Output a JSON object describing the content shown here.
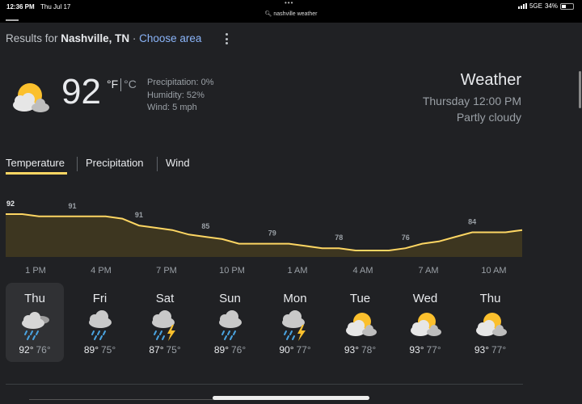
{
  "status_bar": {
    "time": "12:36 PM",
    "date": "Thu Jul 17",
    "dots": "•••",
    "url": "nashville weather",
    "network": "5GE",
    "battery": "34%"
  },
  "header": {
    "results_for": "Results for",
    "location": "Nashville, TN",
    "separator": "·",
    "choose_area": "Choose area"
  },
  "current": {
    "temp": "92",
    "unit_f": "°F",
    "unit_c": "°C",
    "precipitation": "Precipitation: 0%",
    "humidity": "Humidity: 52%",
    "wind": "Wind: 5 mph",
    "title": "Weather",
    "time": "Thursday 12:00 PM",
    "condition": "Partly cloudy",
    "icon": "partly-cloudy-icon"
  },
  "tabs": [
    {
      "label": "Temperature",
      "active": true
    },
    {
      "label": "Precipitation",
      "active": false
    },
    {
      "label": "Wind",
      "active": false
    }
  ],
  "colors": {
    "accent": "#fdd663",
    "chart_fill": "#3d3620",
    "background": "#202124"
  },
  "chart_data": {
    "type": "area",
    "series": [
      {
        "values": [
          92,
          92,
          91,
          91,
          91,
          91,
          91,
          90,
          87,
          86,
          85,
          83,
          82,
          81,
          79,
          79,
          79,
          79,
          78,
          77,
          77,
          76,
          76,
          76,
          77,
          79,
          80,
          82,
          84,
          84,
          84,
          85
        ]
      }
    ],
    "data_labels": [
      {
        "index": 0,
        "text": "92"
      },
      {
        "index": 4,
        "text": "91"
      },
      {
        "index": 8,
        "text": "91"
      },
      {
        "index": 12,
        "text": "85"
      },
      {
        "index": 16,
        "text": "79"
      },
      {
        "index": 20,
        "text": "78"
      },
      {
        "index": 24,
        "text": "76"
      },
      {
        "index": 28,
        "text": "84"
      }
    ],
    "x_labels": [
      "1 PM",
      "4 PM",
      "7 PM",
      "10 PM",
      "1 AM",
      "4 AM",
      "7 AM",
      "10 AM"
    ]
  },
  "forecast": [
    {
      "day": "Thu",
      "hi": "92°",
      "lo": "76°",
      "icon": "rain-cloud-icon",
      "selected": true
    },
    {
      "day": "Fri",
      "hi": "89°",
      "lo": "75°",
      "icon": "rain-icon",
      "selected": false
    },
    {
      "day": "Sat",
      "hi": "87°",
      "lo": "75°",
      "icon": "thunderstorm-icon",
      "selected": false
    },
    {
      "day": "Sun",
      "hi": "89°",
      "lo": "76°",
      "icon": "rain-icon",
      "selected": false
    },
    {
      "day": "Mon",
      "hi": "90°",
      "lo": "77°",
      "icon": "thunderstorm-icon",
      "selected": false
    },
    {
      "day": "Tue",
      "hi": "93°",
      "lo": "78°",
      "icon": "partly-cloudy-icon",
      "selected": false
    },
    {
      "day": "Wed",
      "hi": "93°",
      "lo": "77°",
      "icon": "partly-cloudy-icon",
      "selected": false
    },
    {
      "day": "Thu",
      "hi": "93°",
      "lo": "77°",
      "icon": "partly-cloudy-icon",
      "selected": false
    }
  ]
}
